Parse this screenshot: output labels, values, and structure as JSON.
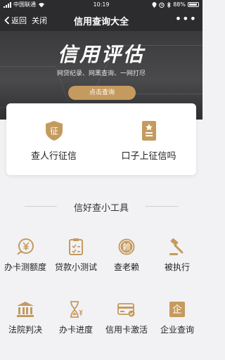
{
  "status_bar": {
    "carrier": "中国联通",
    "time": "10:19",
    "battery": "88%"
  },
  "nav": {
    "back": "返回",
    "close": "关闭",
    "title": "信用查询大全",
    "more": "•••"
  },
  "hero": {
    "title": "信用评估",
    "subtitle": "网贷纪录、网黑查询、一网打尽",
    "button": "点击查询"
  },
  "card": {
    "items": [
      {
        "label": "查人行征信",
        "icon": "shield-icon",
        "icon_text": "征"
      },
      {
        "label": "口子上征信吗",
        "icon": "document-icon"
      }
    ]
  },
  "tools_section": {
    "title": "信好查小工具",
    "items": [
      {
        "label": "办卡测额度",
        "icon": "yen-coin-icon"
      },
      {
        "label": "贷款小测试",
        "icon": "clipboard-icon"
      },
      {
        "label": "查老赖",
        "icon": "stamp-icon",
        "icon_text": "赖"
      },
      {
        "label": "被执行",
        "icon": "gavel-icon"
      },
      {
        "label": "法院判决",
        "icon": "courthouse-icon"
      },
      {
        "label": "办卡进度",
        "icon": "hourglass-icon"
      },
      {
        "label": "信用卡激活",
        "icon": "credit-card-icon"
      },
      {
        "label": "企业查询",
        "icon": "company-icon",
        "icon_text": "企"
      }
    ]
  },
  "colors": {
    "accent": "#c59a5e",
    "dark": "#2c2c2e"
  }
}
